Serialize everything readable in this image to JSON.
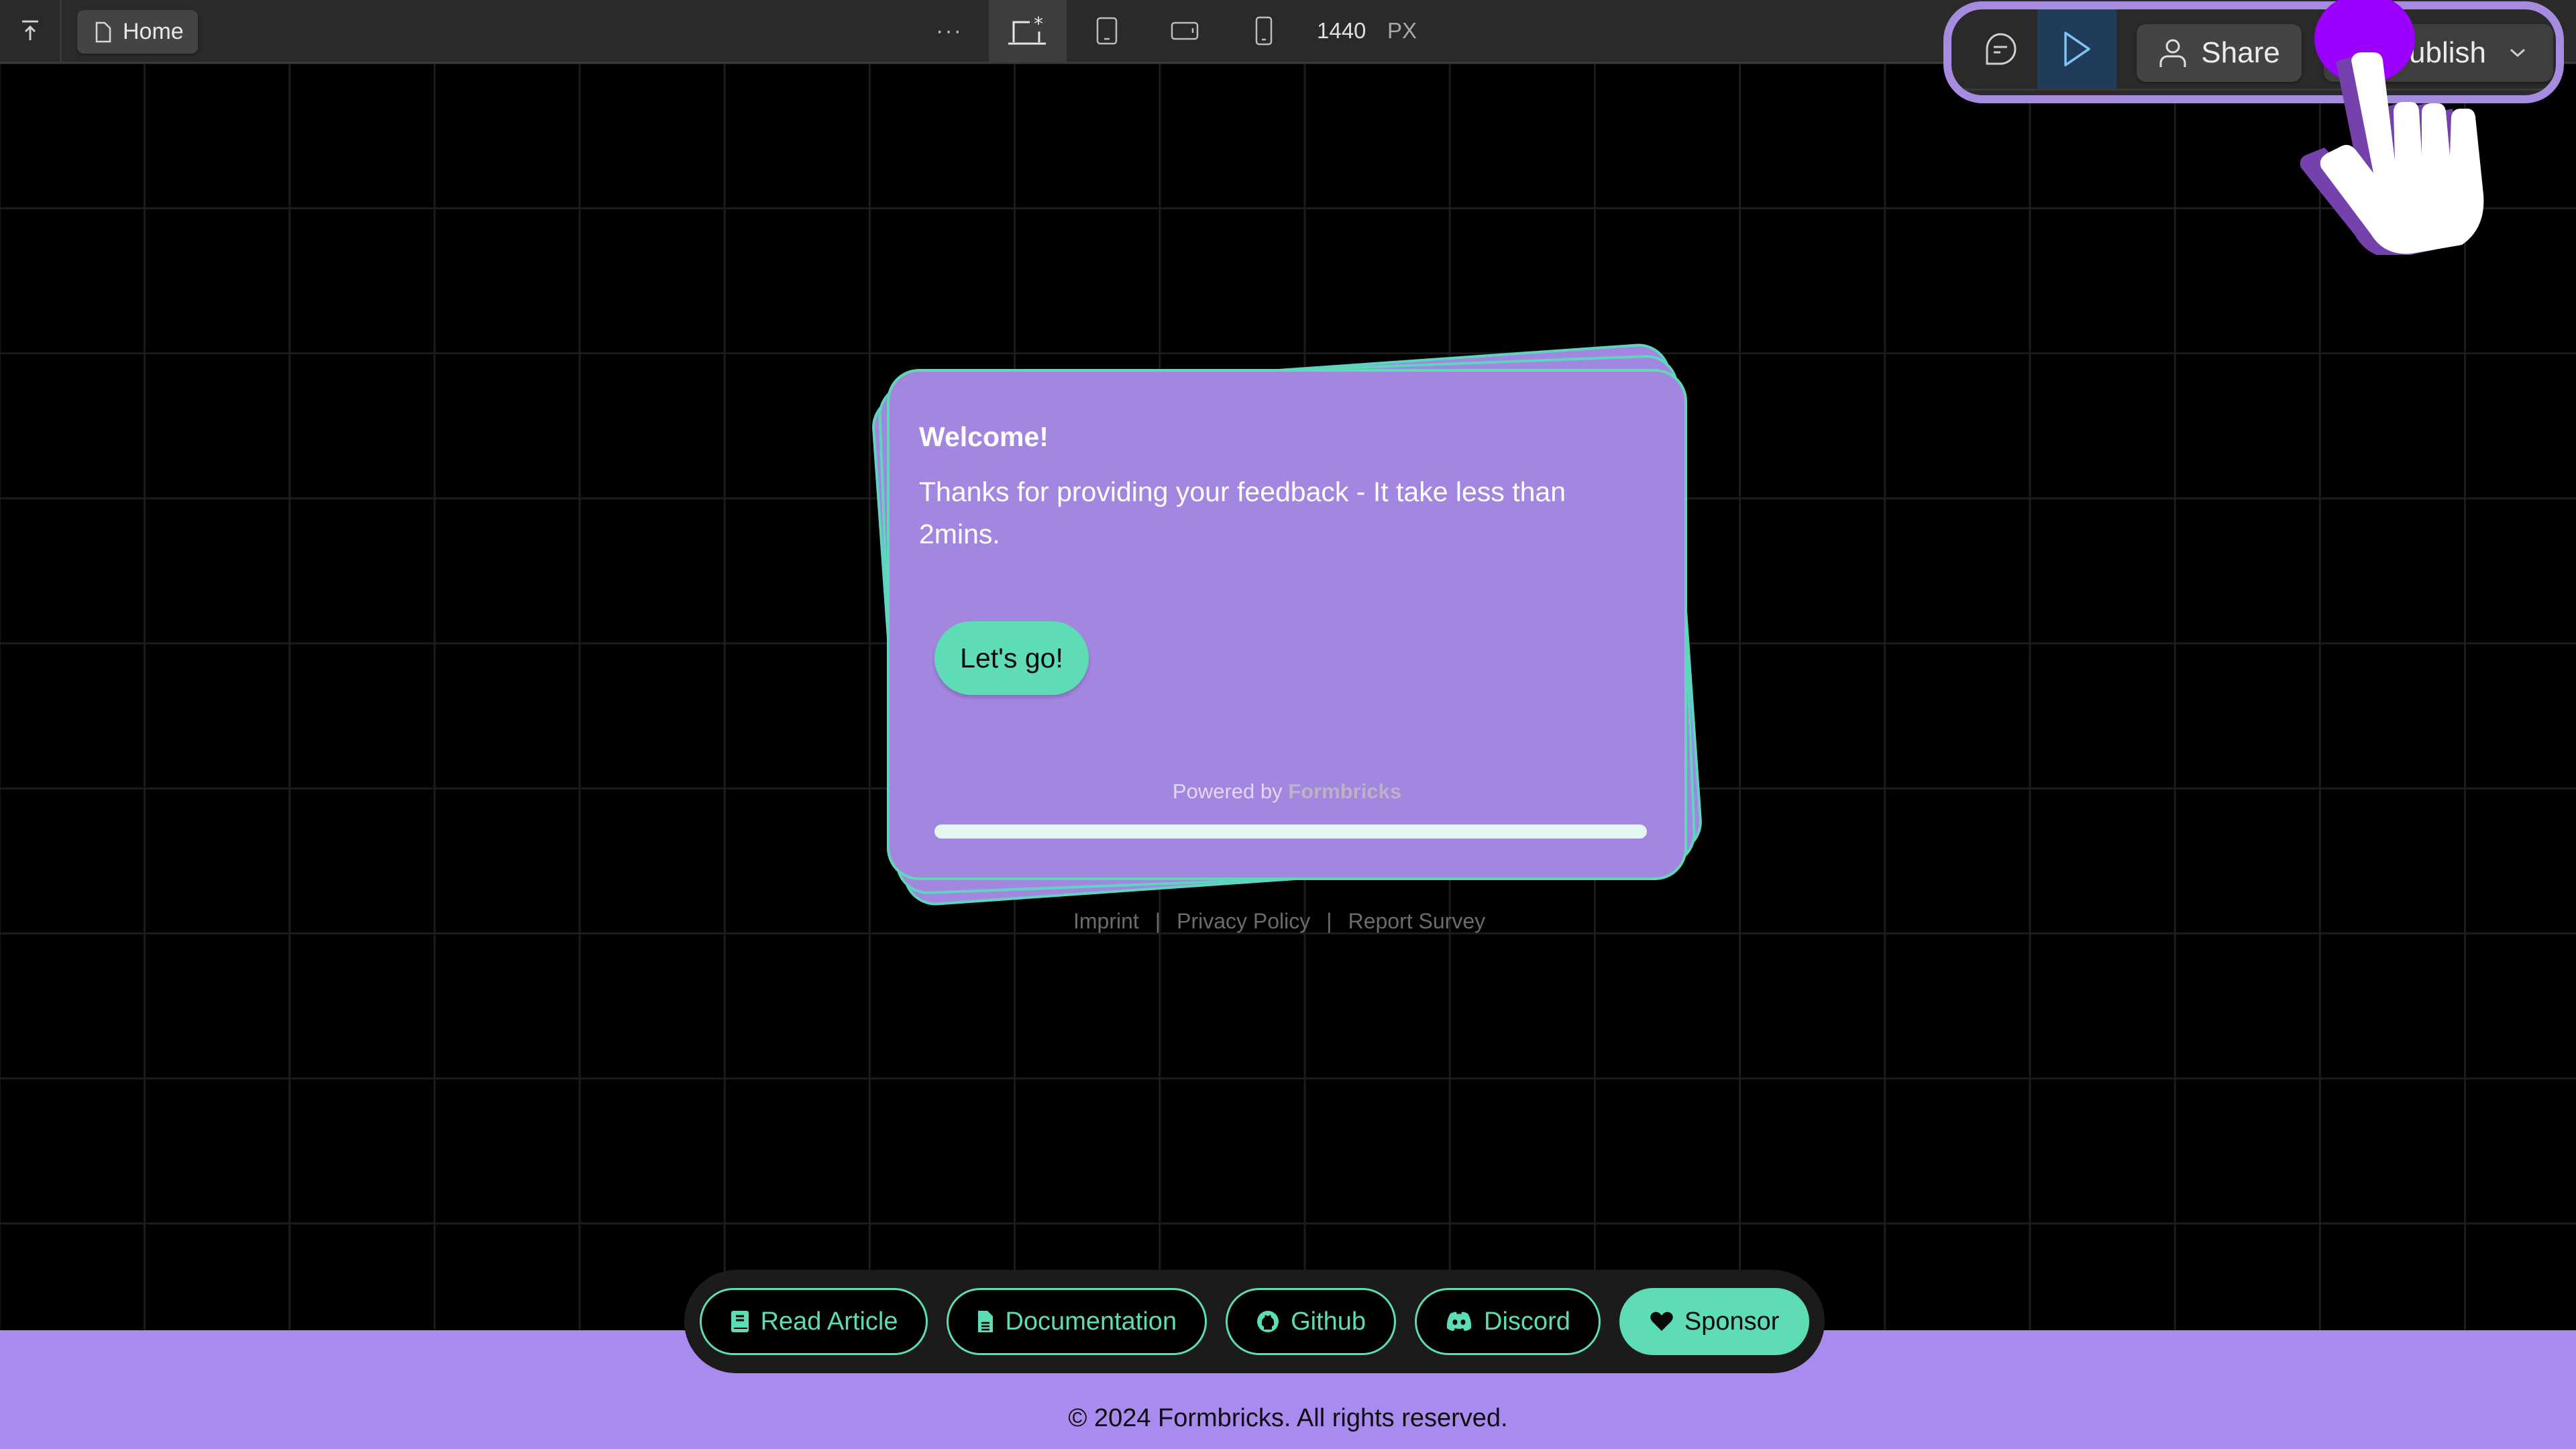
{
  "topbar": {
    "collapse_icon": "arrow-up-to-line-icon",
    "page_tab": {
      "label": "Home",
      "icon": "file-icon"
    },
    "more_label": "···",
    "devices": [
      {
        "name": "desktop",
        "icon": "laptop-asterisk-icon",
        "active": true
      },
      {
        "name": "tablet",
        "icon": "tablet-icon",
        "active": false
      },
      {
        "name": "tablet-landscape",
        "icon": "tablet-landscape-icon",
        "active": false
      },
      {
        "name": "mobile",
        "icon": "phone-icon",
        "active": false
      }
    ],
    "canvas_width": "1440",
    "canvas_unit": "PX",
    "comment_icon": "comment-icon",
    "preview_icon": "play-icon",
    "share_label": "Share",
    "publish_label": "Publish"
  },
  "survey": {
    "title": "Welcome!",
    "body": "Thanks for providing your feedback - It take less than 2mins.",
    "cta_label": "Let's go!",
    "powered_by_prefix": "Powered by",
    "powered_by_brand": "Formbricks",
    "progress_fraction": 0
  },
  "legal_links": [
    "Imprint",
    "Privacy Policy",
    "Report Survey"
  ],
  "legal_separator": "|",
  "bottom_nav": [
    {
      "label": "Read Article",
      "icon": "book-icon",
      "filled": false
    },
    {
      "label": "Documentation",
      "icon": "document-icon",
      "filled": false
    },
    {
      "label": "Github",
      "icon": "github-icon",
      "filled": false
    },
    {
      "label": "Discord",
      "icon": "discord-icon",
      "filled": false
    },
    {
      "label": "Sponsor",
      "icon": "heart-icon",
      "filled": true
    }
  ],
  "footer": {
    "copyright": "© 2024 Formbricks. All rights reserved."
  },
  "colors": {
    "card_bg": "#a386e0",
    "accent": "#5edcb6",
    "footer_bg": "#a98aef",
    "highlight_frame": "#a68bdf",
    "click_indicator": "#9b00ff"
  }
}
